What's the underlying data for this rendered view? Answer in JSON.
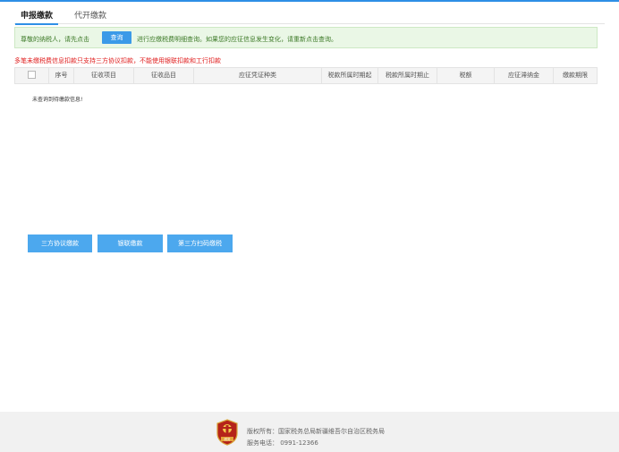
{
  "tabs": [
    {
      "label": "申报缴款",
      "active": true
    },
    {
      "label": "代开缴款",
      "active": false
    }
  ],
  "notice": {
    "prefix": "尊敬的纳税人，请先点击",
    "button_label": "查询",
    "suffix": "进行应缴税费明细查询。如果您的应征信息发生变化，请重新点击查询。"
  },
  "warning": "多笔未缴税费信息扣款只支持三方协议扣款，不能使用银联扣款和工行扣款",
  "table": {
    "columns": [
      "序号",
      "征收项目",
      "征收品目",
      "应征凭证种类",
      "税款所属时期起",
      "税款所属时期止",
      "税额",
      "应征滞纳金",
      "缴款期限"
    ],
    "empty_text": "未查询到待缴款信息!"
  },
  "actions": {
    "tripartite": "三方协议缴款",
    "unionpay": "银联缴款",
    "qrcode": "第三方扫码缴税"
  },
  "footer": {
    "copyright": "版权所有：国家税务总局新疆维吾尔自治区税务局",
    "phone": "服务电话： 0991-12366",
    "logo_text": "税务",
    "logo_icon": "tax-emblem-icon"
  },
  "colors": {
    "accent": "#2e8fe6",
    "button": "#4ca8ee",
    "warning": "#e02020",
    "notice_bg": "#eaf7e6"
  }
}
